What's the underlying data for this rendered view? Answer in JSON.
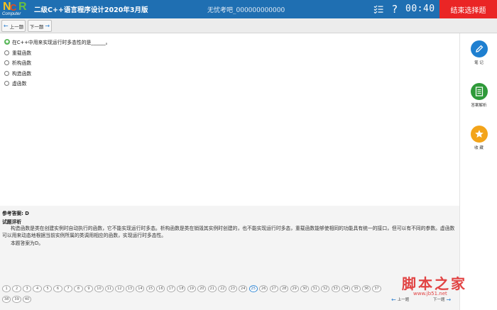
{
  "header": {
    "logo_text": "NCRE",
    "logo_sub": "Computer",
    "title": "二级C++语言程序设计2020年3月版",
    "candidate": "无忧考吧_000000000000",
    "timer": "00:40",
    "end_button": "结束选择题",
    "help_symbol": "?"
  },
  "toolbar": {
    "prev_label": "上一题",
    "next_label": "下一题"
  },
  "question": {
    "text": "在C++中用来实现运行时多态性的是______。",
    "options": [
      "重载函数",
      "析构函数",
      "构造函数",
      "虚函数"
    ]
  },
  "side_tools": [
    {
      "label": "笔  记",
      "icon": "pencil-icon",
      "color": "#1e7fd0"
    },
    {
      "label": "答案解析",
      "icon": "document-icon",
      "color": "#2f9a3a"
    },
    {
      "label": "收  藏",
      "icon": "star-icon",
      "color": "#f3a41a"
    }
  ],
  "analysis": {
    "answer_label": "参考答案:",
    "answer_value": "D",
    "title": "试题评析",
    "text": "构造函数是类在创建实例时自动执行的函数，它不能实现运行时多态。析构函数是类在销毁其实例时创建的，也不能实现运行时多态，重载函数能够使相同的功能具有统一的接口，但可以有不同的参数。虚函数可以用来动态地根据当前实例所属的类调用相应的函数，实现运行时多态性。",
    "final": "本题答案为D。"
  },
  "footer": {
    "numbers": [
      "1",
      "2",
      "3",
      "4",
      "5",
      "6",
      "7",
      "8",
      "9",
      "10",
      "11",
      "12",
      "13",
      "14",
      "15",
      "16",
      "17",
      "18",
      "19",
      "20",
      "21",
      "22",
      "23",
      "24",
      "25",
      "26",
      "27",
      "28",
      "29",
      "30",
      "31",
      "32",
      "33",
      "34",
      "35",
      "36",
      "37",
      "38",
      "39",
      "40"
    ],
    "current": "25",
    "prev_label": "上一题",
    "next_label": "下一题"
  },
  "watermark": {
    "text": "脚本之家",
    "url": "www.jb51.net"
  },
  "colors": {
    "header_blue": "#1f6fb2",
    "end_red": "#ea2525"
  }
}
